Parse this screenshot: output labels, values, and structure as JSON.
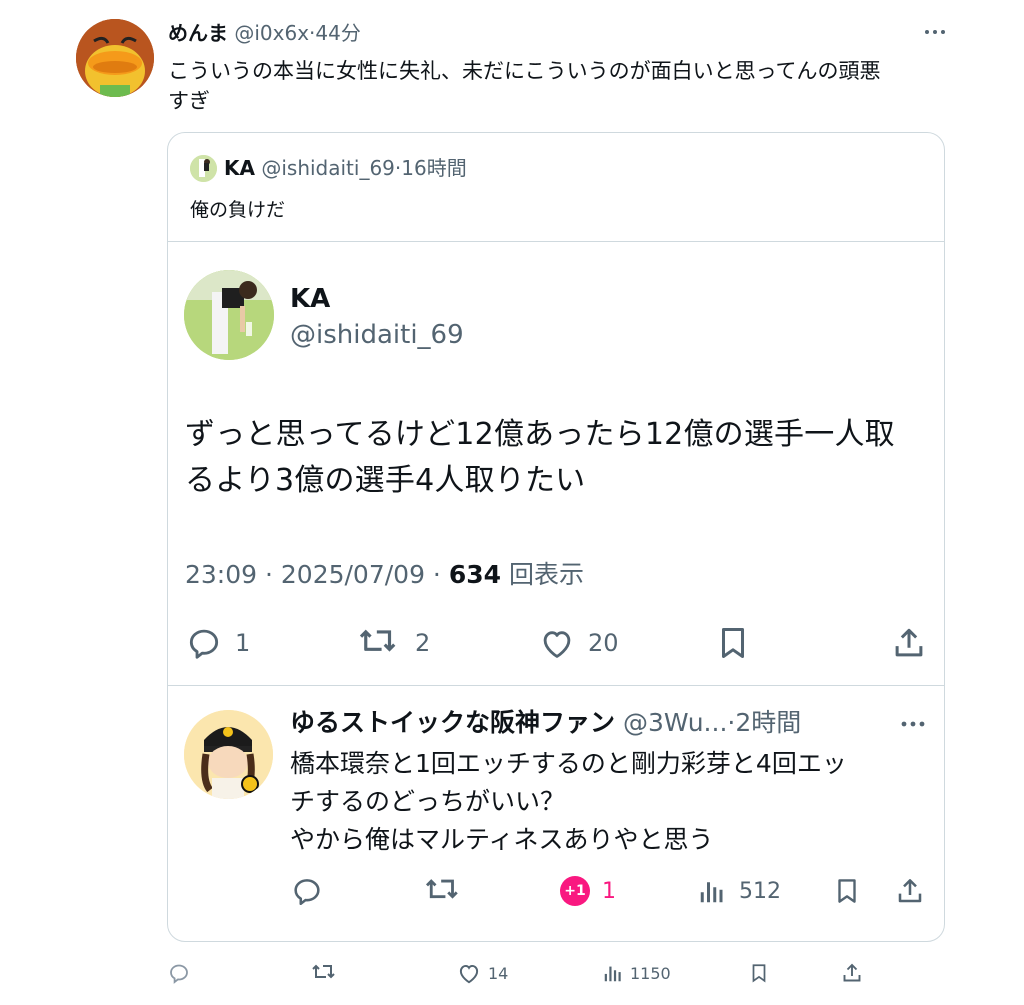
{
  "top_tweet": {
    "author_name": "めんま",
    "author_handle": "@i0x6x",
    "separator": "·",
    "time": "44分",
    "text_line1": "こういうの本当に女性に失礼、未だにこういうのが面白いと思ってんの頭悪",
    "text_line2": "すぎ",
    "actions": {
      "reply_count": "",
      "retweet_count": "",
      "like_count": "14",
      "views_count": "1150"
    }
  },
  "quote": {
    "author_name": "KA",
    "author_handle": "@ishidaiti_69",
    "separator": "·",
    "time": "16時間",
    "text": "俺の負けだ"
  },
  "main_tweet": {
    "author_name": "KA",
    "author_handle": "@ishidaiti_69",
    "text_line1": "ずっと思ってるけど12億あったら12億の選手一人取",
    "text_line2": "るより3億の選手4人取りたい",
    "timestamp": "23:09 · 2025/07/09 · ",
    "views_count": "634",
    "views_label": "回表示",
    "actions": {
      "reply_count": "1",
      "retweet_count": "2",
      "like_count": "20"
    }
  },
  "reply": {
    "author_name": "ゆるストイックな阪神ファン",
    "author_handle": "@3Wu...",
    "separator": "·",
    "time": "2時間",
    "text_line1": "橋本環奈と1回エッチするのと剛力彩芽と4回エッ",
    "text_line2": "チするのどっちがいい？",
    "text_line3": "やから俺はマルティネスありやと思う",
    "actions": {
      "like_badge": "+1",
      "like_count": "1",
      "views_count": "512"
    }
  },
  "colors": {
    "text": "#0f1419",
    "muted": "#536471",
    "border": "#cfd9de",
    "like_pink": "#f91880"
  }
}
